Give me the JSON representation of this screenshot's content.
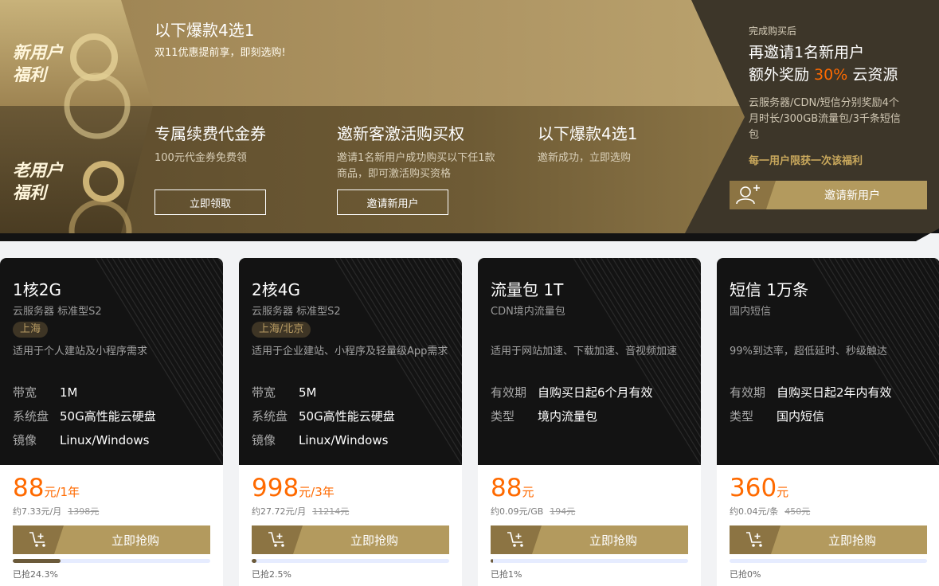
{
  "banner": {
    "new_user_tag": "新用户\n福利",
    "old_user_tag": "老用户\n福利",
    "new_user": {
      "title": "以下爆款4选1",
      "subtitle": "双11优惠提前享，即刻选购!"
    },
    "old_user": [
      {
        "title": "专属续费代金券",
        "desc": "100元代金券免费领",
        "button": "立即领取"
      },
      {
        "title": "邀新客激活购买权",
        "desc": "邀请1名新用户成功购买以下任1款商品，即可激活购买资格",
        "button": "邀请新用户"
      },
      {
        "title": "以下爆款4选1",
        "desc": "邀新成功，立即选购",
        "button": ""
      }
    ],
    "right": {
      "small": "完成购买后",
      "line1": "再邀请1名新用户",
      "line2_pre": "额外奖励 ",
      "line2_accent": "30%",
      "line2_post": " 云资源",
      "desc": "云服务器/CDN/短信分别奖励4个月时长/300GB流量包/3千条短信包",
      "note": "每一用户限获一次该福利",
      "invite_button": "邀请新用户",
      "invite_icon": "add-user-icon"
    },
    "colors": {
      "gold": "#b49a5c",
      "dark": "#3d3629",
      "accent": "#ff6a00"
    }
  },
  "cards": [
    {
      "title": "1核2G",
      "subtitle": "云服务器 标准型S2",
      "region": "上海",
      "desc": "适用于个人建站及小程序需求",
      "specs": [
        {
          "k": "带宽",
          "v": "1M"
        },
        {
          "k": "系统盘",
          "v": "50G高性能云硬盘"
        },
        {
          "k": "镜像",
          "v": "Linux/Windows"
        }
      ],
      "price": "88",
      "unit": "元/1年",
      "per": "约7.33元/月",
      "orig": "1398元",
      "button": "立即抢购",
      "sold_text": "已抢24.3%",
      "sold_percent": 24.3
    },
    {
      "title": "2核4G",
      "subtitle": "云服务器 标准型S2",
      "region": "上海/北京",
      "desc": "适用于企业建站、小程序及轻量级App需求",
      "specs": [
        {
          "k": "带宽",
          "v": "5M"
        },
        {
          "k": "系统盘",
          "v": "50G高性能云硬盘"
        },
        {
          "k": "镜像",
          "v": "Linux/Windows"
        }
      ],
      "price": "998",
      "unit": "元/3年",
      "per": "约27.72元/月",
      "orig": "11214元",
      "button": "立即抢购",
      "sold_text": "已抢2.5%",
      "sold_percent": 2.5
    },
    {
      "title": "流量包 1T",
      "subtitle": "CDN境内流量包",
      "region": "",
      "desc": "适用于网站加速、下载加速、音视频加速",
      "specs": [
        {
          "k": "有效期",
          "v": "自购买日起6个月有效"
        },
        {
          "k": "类型",
          "v": "境内流量包"
        }
      ],
      "price": "88",
      "unit": "元",
      "per": "约0.09元/GB",
      "orig": "194元",
      "button": "立即抢购",
      "sold_text": "已抢1%",
      "sold_percent": 1
    },
    {
      "title": "短信 1万条",
      "subtitle": "国内短信",
      "region": "",
      "desc": "99%到达率，超低延时、秒级触达",
      "specs": [
        {
          "k": "有效期",
          "v": "自购买日起2年内有效"
        },
        {
          "k": "类型",
          "v": "国内短信"
        }
      ],
      "price": "360",
      "unit": "元",
      "per": "约0.04元/条",
      "orig": "450元",
      "button": "立即抢购",
      "sold_text": "已抢0%",
      "sold_percent": 0
    }
  ]
}
